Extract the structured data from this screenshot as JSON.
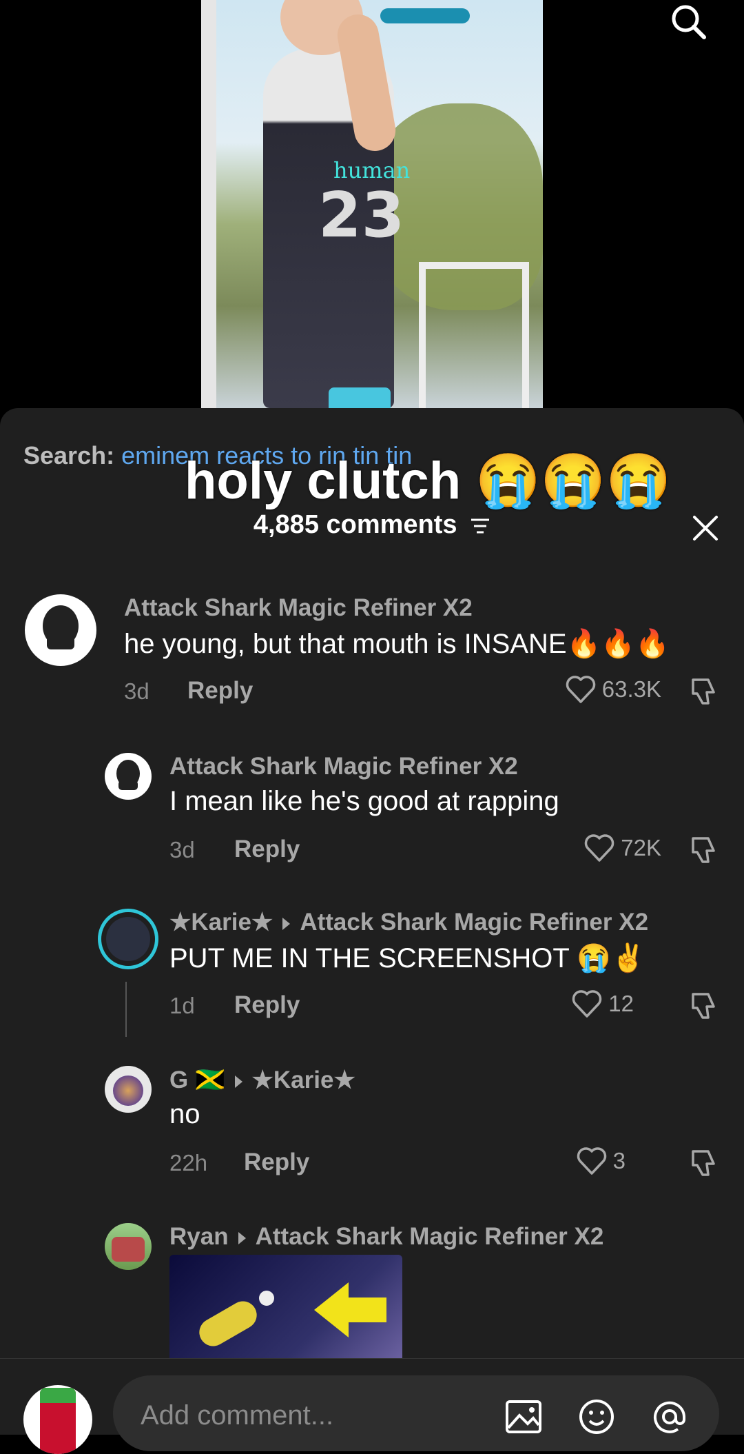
{
  "video": {
    "overlay_text": "human",
    "jersey_number": "23"
  },
  "search": {
    "label": "Search:",
    "query": "eminem reacts to rin tin tin"
  },
  "caption": "holy clutch 😭😭😭",
  "comments_header": {
    "count_label": "4,885 comments"
  },
  "comments": [
    {
      "user": "Attack Shark Magic Refiner X2",
      "reply_to": "",
      "text": "he young, but that mouth is INSANE🔥🔥🔥",
      "age": "3d",
      "reply_label": "Reply",
      "likes": "63.3K"
    },
    {
      "user": "Attack Shark Magic Refiner X2",
      "reply_to": "",
      "text": "I mean like he's good at rapping",
      "age": "3d",
      "reply_label": "Reply",
      "likes": "72K"
    },
    {
      "user": "★Karie★",
      "reply_to": "Attack Shark Magic Refiner X2",
      "text": "PUT ME IN THE SCREENSHOT 😭✌️",
      "age": "1d",
      "reply_label": "Reply",
      "likes": "12"
    },
    {
      "user": "G 🇯🇲",
      "reply_to": "★Karie★",
      "text": "no",
      "age": "22h",
      "reply_label": "Reply",
      "likes": "3"
    },
    {
      "user": "Ryan",
      "reply_to": "Attack Shark Magic Refiner X2"
    }
  ],
  "composer": {
    "placeholder": "Add comment..."
  },
  "colors": {
    "sheet_bg": "#1f1f1f",
    "search_query": "#5fa8f0",
    "username": "#a8a8a8"
  }
}
